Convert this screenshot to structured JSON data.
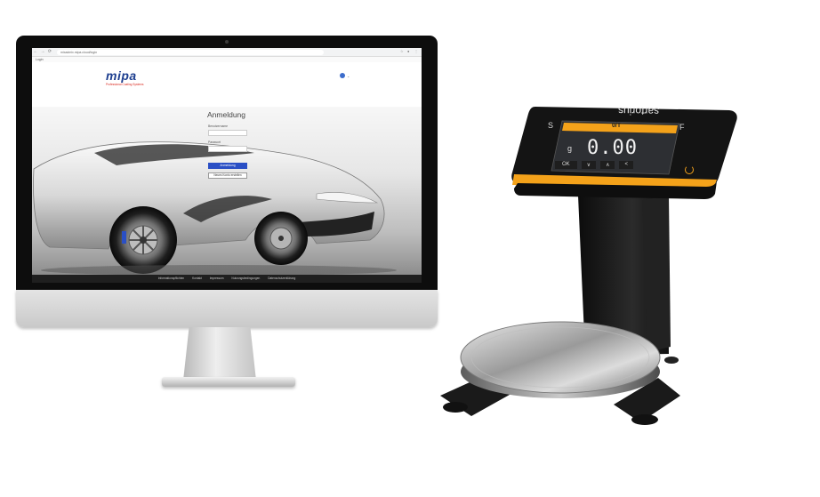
{
  "browser": {
    "back": "←",
    "forward": "→",
    "reload": "⟳",
    "url": "mixadmix.mipa.cloud/login",
    "tab_title": "Login"
  },
  "brand": {
    "logo_text": "mipa",
    "tagline": "Professional Coating Systems",
    "accent_color": "#1d3e8f",
    "tagline_color": "#d9261c"
  },
  "language": {
    "icon": "globe-icon",
    "chevron": "⌄"
  },
  "login": {
    "title": "Anmeldung",
    "username_label": "Benutzername",
    "password_label": "Passwort",
    "submit_label": "Anmeldung",
    "register_label": "Neues Konto erstellen",
    "button_color": "#2a4fc5"
  },
  "footer": {
    "links": [
      "Informationspflichten",
      "Kontakt",
      "Impressum",
      "Nutzungsbedingungen",
      "Datenschutzerklärung"
    ]
  },
  "scale": {
    "brand": "sartorius",
    "display_value": "0.00",
    "unit": "g",
    "header_label": "0/T",
    "left_key": "S",
    "right_key": "F",
    "accent_color": "#f4a21a",
    "keys": [
      "OK",
      "∨",
      "∧",
      "<"
    ],
    "power_icon": "power-icon"
  }
}
